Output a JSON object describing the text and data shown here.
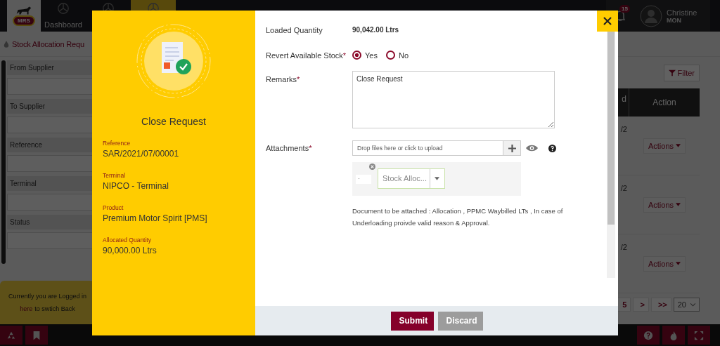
{
  "app": {
    "logo": "MRS",
    "nav": [
      {
        "label": "Dashboard",
        "selected": false
      },
      {
        "selected": false
      },
      {
        "selected": true
      }
    ]
  },
  "page_title": "Stock Allocation Requ",
  "filters": [
    "From Supplier",
    "To Supplier",
    "Reference",
    "Terminal",
    "Status"
  ],
  "login_notice": {
    "text": "Currently you are Logged in",
    "link": "here",
    "rest": "to swtich Back"
  },
  "notifications": {
    "count": "15"
  },
  "user": {
    "name": "Christine",
    "role": "MON"
  },
  "filter_button": "Filter",
  "table": {
    "columns": [
      "d",
      "Action"
    ],
    "rows": [
      {
        "column_1": "/2",
        "action": "Actions"
      },
      {
        "column_1": "/2",
        "action": "Actions"
      },
      {
        "column_1": "/2",
        "action": "Actions"
      }
    ]
  },
  "pagination": {
    "pages": [
      "5",
      ">",
      ">>"
    ],
    "page_size": "20"
  },
  "modal": {
    "title": "Close Request",
    "details": [
      {
        "label": "Reference",
        "value": "SAR/2021/07/00001"
      },
      {
        "label": "Terminal",
        "value": "NIPCO - Terminal"
      },
      {
        "label": "Product",
        "value": "Premium Motor Spirit [PMS]"
      },
      {
        "label": "Allocated Quantity",
        "value": "90,000.00 Ltrs"
      }
    ],
    "loaded_quantity": {
      "label": "Loaded Quantity",
      "value": "90,042.00 Ltrs"
    },
    "revert": {
      "label": "Revert Available Stock",
      "required_mark": "*",
      "options": [
        {
          "label": "Yes",
          "selected": true
        },
        {
          "label": "No",
          "selected": false
        }
      ]
    },
    "remarks": {
      "label": "Remarks",
      "required_mark": "*",
      "value": "Close Request"
    },
    "attachments": {
      "label": "Attachments",
      "required_mark": "*",
      "placeholder": "Drop files here or click to upload",
      "file": {
        "name": "-",
        "type": "Stock Alloc..."
      }
    },
    "note": "Document to be attached : Allocation , PPMC Waybilled LTs , In case of Underloading proivde valid reason & Approval.",
    "buttons": [
      {
        "label": "Submit",
        "kind": "primary"
      },
      {
        "label": "Discard",
        "kind": "secondary"
      }
    ]
  }
}
